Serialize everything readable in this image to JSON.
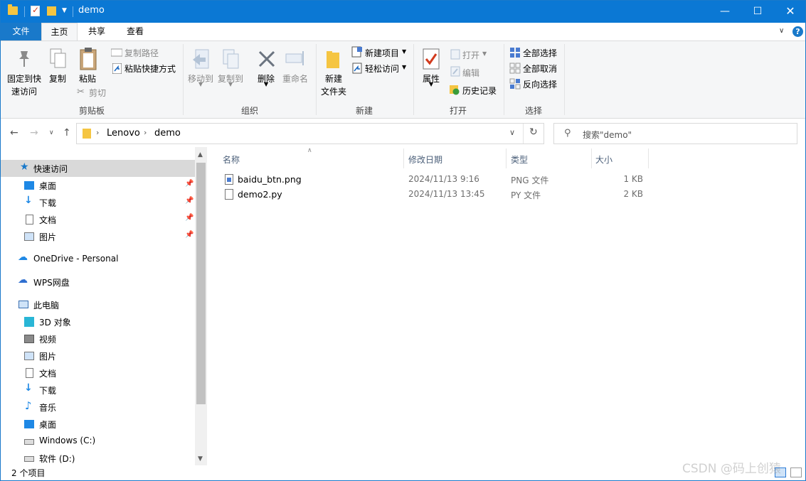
{
  "window": {
    "title": "demo",
    "controls": {
      "minimize": "—",
      "maximize": "☐",
      "close": "✕"
    }
  },
  "ribbon_tabs": {
    "file": "文件",
    "home": "主页",
    "share": "共享",
    "view": "查看"
  },
  "ribbon": {
    "clipboard": {
      "pin_quick_line1": "固定到快",
      "pin_quick_line2": "速访问",
      "copy": "复制",
      "paste": "粘贴",
      "copy_path": "复制路径",
      "paste_shortcut": "粘贴快捷方式",
      "cut": "剪切",
      "label": "剪贴板"
    },
    "organize": {
      "move_to": "移动到",
      "copy_to": "复制到",
      "delete": "删除",
      "rename": "重命名",
      "label": "组织"
    },
    "new": {
      "new_folder_line1": "新建",
      "new_folder_line2": "文件夹",
      "new_item": "新建项目",
      "easy_access": "轻松访问",
      "label": "新建"
    },
    "open": {
      "properties": "属性",
      "open": "打开",
      "edit": "编辑",
      "history": "历史记录",
      "label": "打开"
    },
    "select": {
      "select_all": "全部选择",
      "select_none": "全部取消",
      "invert": "反向选择",
      "label": "选择"
    }
  },
  "address": {
    "segments": [
      "Lenovo",
      "demo"
    ],
    "search_placeholder": "搜索\"demo\""
  },
  "nav": {
    "quick_access": "快速访问",
    "quick_items": [
      "桌面",
      "下载",
      "文档",
      "图片"
    ],
    "onedrive": "OneDrive - Personal",
    "wps": "WPS网盘",
    "this_pc": "此电脑",
    "pc_items": [
      "3D 对象",
      "视频",
      "图片",
      "文档",
      "下载",
      "音乐",
      "桌面",
      "Windows (C:)",
      "软件 (D:)"
    ]
  },
  "columns": {
    "name": "名称",
    "date": "修改日期",
    "type": "类型",
    "size": "大小"
  },
  "files": [
    {
      "name": "baidu_btn.png",
      "date": "2024/11/13 9:16",
      "type": "PNG 文件",
      "size": "1 KB"
    },
    {
      "name": "demo2.py",
      "date": "2024/11/13 13:45",
      "type": "PY 文件",
      "size": "2 KB"
    }
  ],
  "status": {
    "count": "2 个项目"
  },
  "watermark": "CSDN @码上创猿",
  "colors": {
    "titlebar": "#0b78d4",
    "accent": "#1979ca",
    "folder": "#f5c542",
    "selection": "#d9d9d9"
  }
}
